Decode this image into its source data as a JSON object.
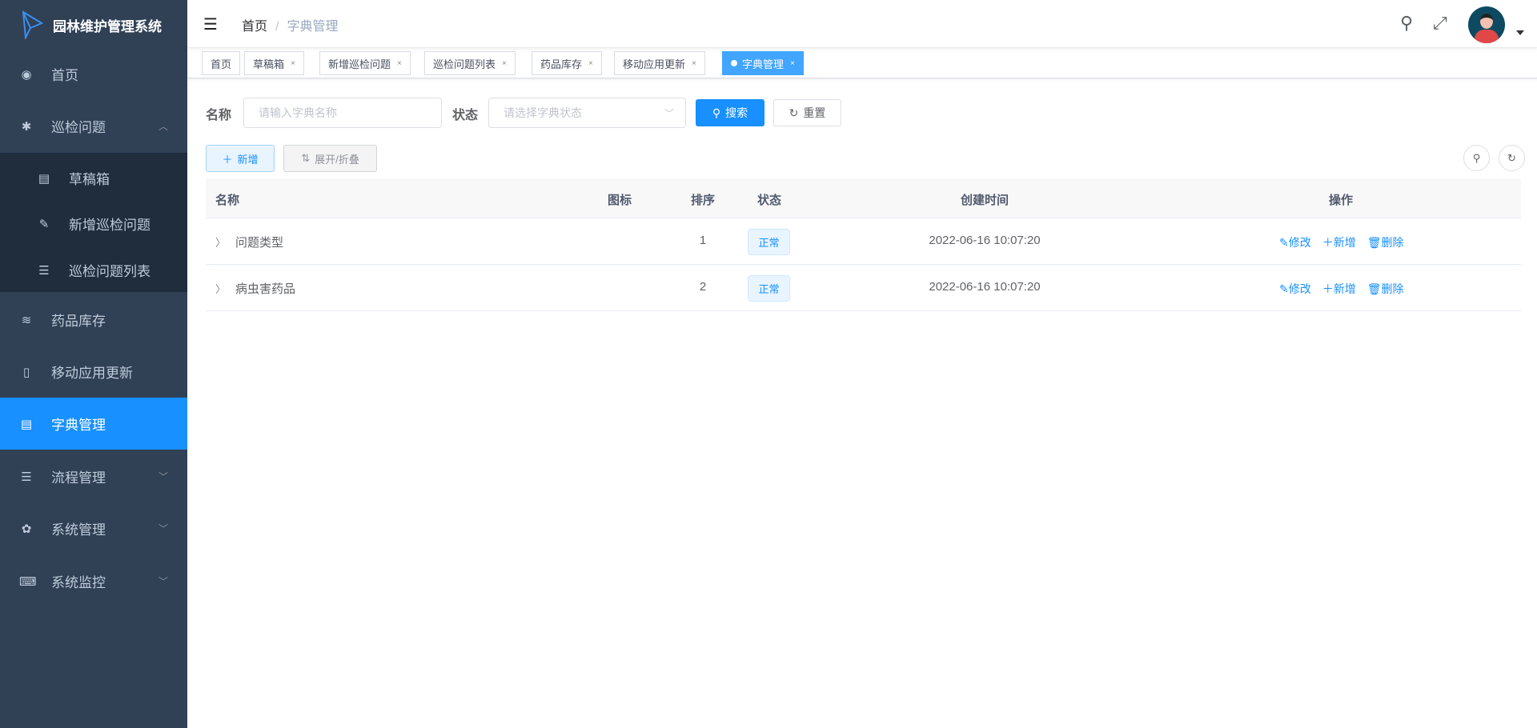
{
  "app": {
    "title": "园林维护管理系统"
  },
  "sidebar": {
    "items": [
      {
        "label": "首页",
        "icon": "dashboard-icon"
      },
      {
        "label": "巡检问题",
        "icon": "bug-icon"
      },
      {
        "label": "草稿箱",
        "icon": "document-icon"
      },
      {
        "label": "新增巡检问题",
        "icon": "edit-icon"
      },
      {
        "label": "巡检问题列表",
        "icon": "list-icon"
      },
      {
        "label": "药品库存",
        "icon": "layers-icon"
      },
      {
        "label": "移动应用更新",
        "icon": "phone-icon"
      },
      {
        "label": "字典管理",
        "icon": "dict-icon"
      },
      {
        "label": "流程管理",
        "icon": "list-icon"
      },
      {
        "label": "系统管理",
        "icon": "gear-icon"
      },
      {
        "label": "系统监控",
        "icon": "monitor-icon"
      }
    ]
  },
  "breadcrumb": {
    "home": "首页",
    "current": "字典管理"
  },
  "tabs": [
    {
      "label": "首页"
    },
    {
      "label": "草稿箱"
    },
    {
      "label": "新增巡检问题"
    },
    {
      "label": "巡检问题列表"
    },
    {
      "label": "药品库存"
    },
    {
      "label": "移动应用更新"
    },
    {
      "label": "字典管理"
    }
  ],
  "search": {
    "name_label": "名称",
    "name_placeholder": "请输入字典名称",
    "status_label": "状态",
    "status_placeholder": "请选择字典状态",
    "search_btn": "搜索",
    "reset_btn": "重置"
  },
  "toolbar": {
    "add": "新增",
    "expand": "展开/折叠"
  },
  "table": {
    "headers": {
      "name": "名称",
      "icon": "图标",
      "sort": "排序",
      "status": "状态",
      "created": "创建时间",
      "ops": "操作"
    },
    "rows": [
      {
        "name": "问题类型",
        "sort": "1",
        "status": "正常",
        "created": "2022-06-16 10:07:20"
      },
      {
        "name": "病虫害药品",
        "sort": "2",
        "status": "正常",
        "created": "2022-06-16 10:07:20"
      }
    ],
    "actions": {
      "edit": "修改",
      "add": "新增",
      "delete": "删除"
    }
  },
  "colors": {
    "sidebar": "#304156",
    "accent": "#1890ff"
  }
}
